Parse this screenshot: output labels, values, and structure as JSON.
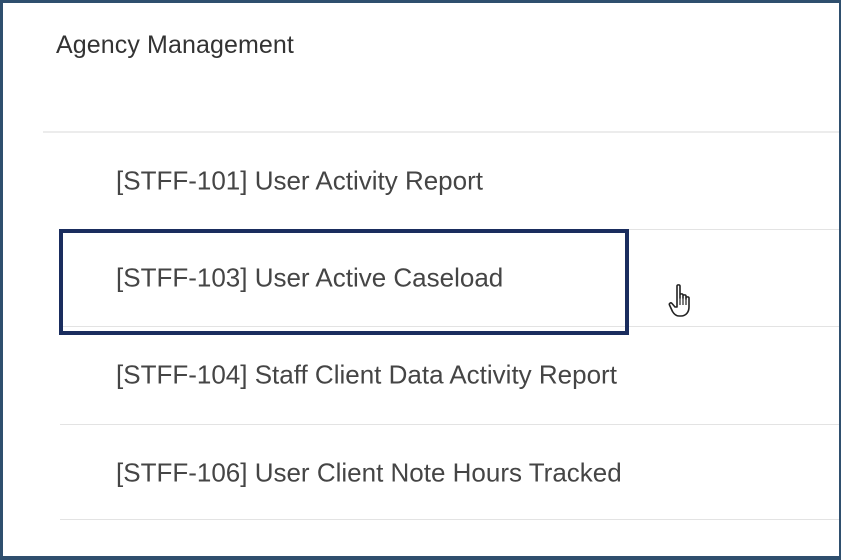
{
  "section": {
    "title": "Agency Management"
  },
  "reports": [
    {
      "label": "[STFF-101] User Activity Report"
    },
    {
      "label": "[STFF-103] User Active Caseload"
    },
    {
      "label": "[STFF-104] Staff Client Data Activity Report"
    },
    {
      "label": "[STFF-106] User Client Note Hours Tracked"
    }
  ],
  "highlight": {
    "color": "#1a2d5e",
    "target": "[STFF-103] User Active Caseload"
  },
  "cursor": {
    "icon": "hand-pointer-icon"
  }
}
